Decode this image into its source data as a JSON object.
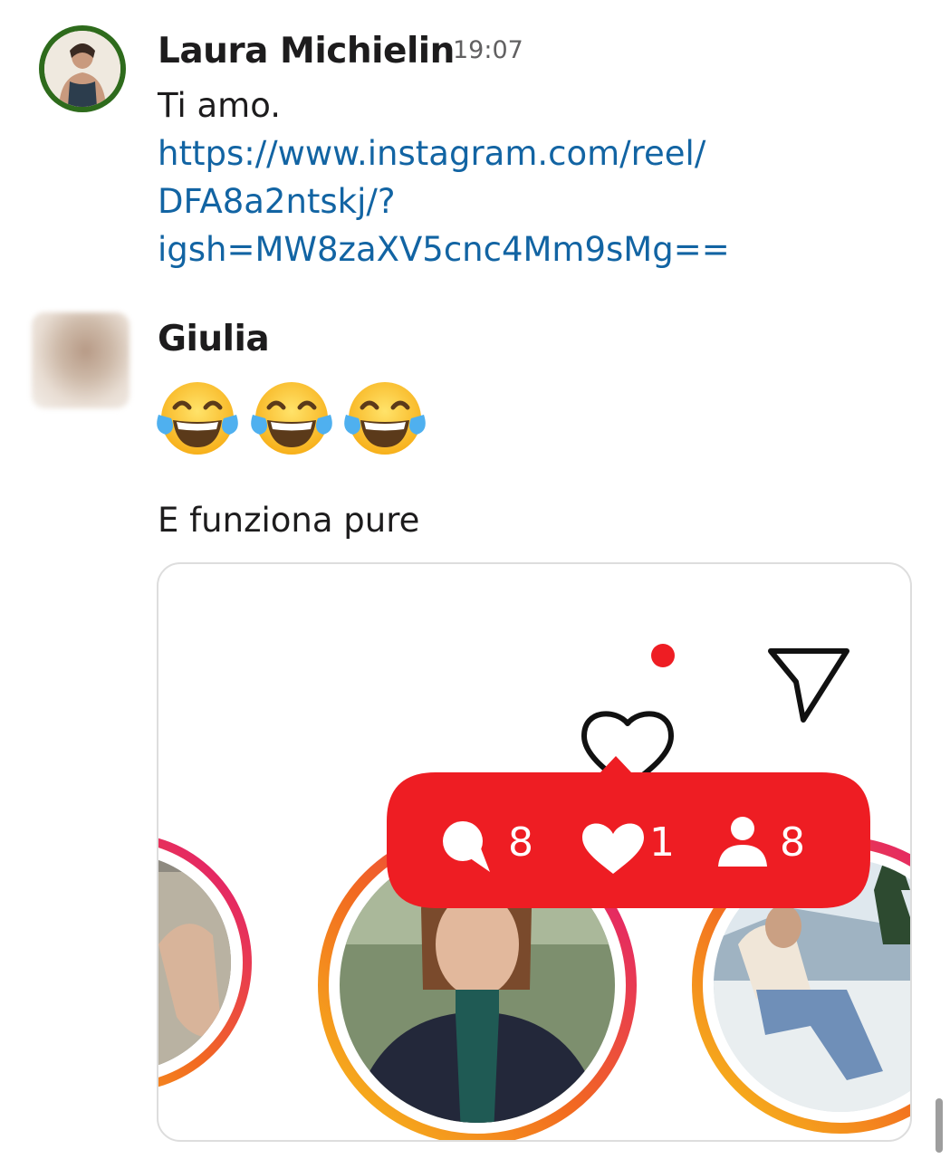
{
  "messages": [
    {
      "author": "Laura Michielin",
      "time": "19:07",
      "text": "Ti amo.",
      "link_lines": [
        "https://www.instagram.com/reel/",
        "DFA8a2ntskj/?",
        "igsh=MW8zaXV5cnc4Mm9sMg=="
      ]
    },
    {
      "author": "Giulia",
      "emojis": [
        "😂",
        "😂",
        "😂"
      ],
      "text": "E funziona pure"
    }
  ],
  "attachment": {
    "icons": [
      "heart-icon",
      "send-icon",
      "comment-icon",
      "like-icon",
      "follower-icon"
    ],
    "notification": {
      "comments": "8",
      "likes": "1",
      "followers": "8"
    },
    "colors": {
      "notification_red": "#ee1d23",
      "ring_orange": "#f7a21b",
      "ring_pink": "#e0127a"
    }
  }
}
